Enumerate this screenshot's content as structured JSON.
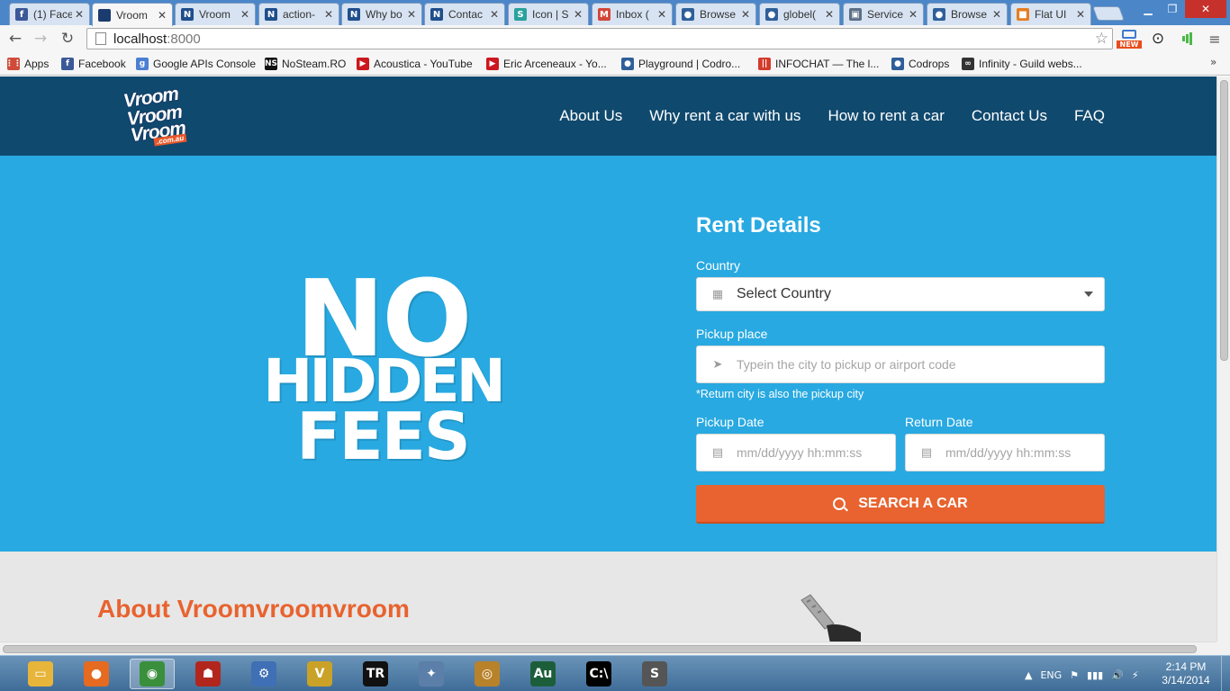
{
  "browser": {
    "tabs": [
      {
        "title": "(1) Face",
        "favicon": "facebook-icon",
        "color": "#3b5998",
        "glyph": "f"
      },
      {
        "title": "Vroom",
        "favicon": "vroom-icon",
        "color": "#1b3b6f",
        "glyph": "",
        "active": true
      },
      {
        "title": "Vroom",
        "favicon": "n-icon",
        "color": "#1f4e8c",
        "glyph": "N"
      },
      {
        "title": "action-",
        "favicon": "n-icon",
        "color": "#1f4e8c",
        "glyph": "N"
      },
      {
        "title": "Why bo",
        "favicon": "n-icon",
        "color": "#1f4e8c",
        "glyph": "N"
      },
      {
        "title": "Contac",
        "favicon": "n-icon",
        "color": "#1f4e8c",
        "glyph": "N"
      },
      {
        "title": "Icon | S",
        "favicon": "s-icon",
        "color": "#29a19c",
        "glyph": "S"
      },
      {
        "title": "Inbox (",
        "favicon": "gmail-icon",
        "color": "#d44638",
        "glyph": "M"
      },
      {
        "title": "Browse",
        "favicon": "drop-icon",
        "color": "#2f5f9a",
        "glyph": "●"
      },
      {
        "title": "globel(",
        "favicon": "drop-icon",
        "color": "#2f5f9a",
        "glyph": "●"
      },
      {
        "title": "Service",
        "favicon": "service-icon",
        "color": "#5b6f86",
        "glyph": "▣"
      },
      {
        "title": "Browse",
        "favicon": "drop-icon",
        "color": "#2f5f9a",
        "glyph": "●"
      },
      {
        "title": "Flat UI",
        "favicon": "flatui-icon",
        "color": "#e67e22",
        "glyph": "■"
      }
    ],
    "tab_close_glyph": "✕",
    "url_host": "localhost",
    "url_port": ":8000",
    "new_badge": "NEW",
    "bookmarks": [
      {
        "label": "Apps",
        "icon": "apps-grid-icon",
        "color": "#d04b3a",
        "glyph": "⋮⋮"
      },
      {
        "label": "Facebook",
        "icon": "facebook-icon",
        "color": "#3b5998",
        "glyph": "f"
      },
      {
        "label": "Google APIs Console",
        "icon": "google-icon",
        "color": "#4a7fd4",
        "glyph": "g"
      },
      {
        "label": "NoSteam.RO",
        "icon": "ns-icon",
        "color": "#111111",
        "glyph": "NS"
      },
      {
        "label": "Acoustica - YouTube",
        "icon": "youtube-icon",
        "color": "#cc181e",
        "glyph": "▶"
      },
      {
        "label": "Eric Arceneaux - Yo...",
        "icon": "youtube-icon",
        "color": "#cc181e",
        "glyph": "▶"
      },
      {
        "label": "Playground | Codro...",
        "icon": "codrops-icon",
        "color": "#2f5f9a",
        "glyph": "●"
      },
      {
        "label": "INFOCHAT — The l...",
        "icon": "infochat-icon",
        "color": "#d33b2c",
        "glyph": "||"
      },
      {
        "label": "Codrops",
        "icon": "codrops-icon",
        "color": "#2f5f9a",
        "glyph": "●"
      },
      {
        "label": "Infinity - Guild webs...",
        "icon": "infinity-icon",
        "color": "#333333",
        "glyph": "∞"
      }
    ],
    "bookmarks_more": "»"
  },
  "site": {
    "logo_lines": [
      "Vroom",
      "Vroom",
      "Vroom"
    ],
    "logo_sub": ".com.au",
    "nav": [
      "About Us",
      "Why rent a car with us",
      "How to rent a car",
      "Contact Us",
      "FAQ"
    ],
    "hero_words": [
      "NO",
      "HIDDEN",
      "FEES"
    ],
    "form": {
      "title": "Rent Details",
      "country_label": "Country",
      "country_value": "Select Country",
      "pickup_label": "Pickup place",
      "pickup_placeholder": "Typein the city to pickup or airport code",
      "hint": "*Return city is also the pickup city",
      "pickup_date_label": "Pickup Date",
      "pickup_date_placeholder": "mm/dd/yyyy hh:mm:ss",
      "return_date_label": "Return Date",
      "return_date_placeholder": "mm/dd/yyyy hh:mm:ss",
      "button": "SEARCH A CAR"
    },
    "about_title": "About Vroomvroomvroom",
    "colors": {
      "header": "#10496e",
      "hero": "#28a9e1",
      "accent": "#e8632f"
    }
  },
  "taskbar": {
    "apps": [
      {
        "name": "explorer-icon",
        "color": "#e6b53a",
        "glyph": "▭"
      },
      {
        "name": "firefox-icon",
        "color": "#e66a1f",
        "glyph": "●"
      },
      {
        "name": "chrome-icon",
        "color": "#3a8f3c",
        "glyph": "◉",
        "active": true
      },
      {
        "name": "ninja-icon",
        "color": "#b3261e",
        "glyph": "☗"
      },
      {
        "name": "network-tool-icon",
        "color": "#3f6fb5",
        "glyph": "⚙"
      },
      {
        "name": "v-app-icon",
        "color": "#c9a227",
        "glyph": "V"
      },
      {
        "name": "tr-app-icon",
        "color": "#111111",
        "glyph": "TR"
      },
      {
        "name": "starcraft-icon",
        "color": "#5b7fa8",
        "glyph": "✦"
      },
      {
        "name": "hearthstone-icon",
        "color": "#b8822a",
        "glyph": "◎"
      },
      {
        "name": "audition-icon",
        "color": "#1d5e3a",
        "glyph": "Au"
      },
      {
        "name": "cmd-icon",
        "color": "#000000",
        "glyph": "C:\\"
      },
      {
        "name": "sublime-icon",
        "color": "#555555",
        "glyph": "S"
      }
    ],
    "tray": [
      "▲",
      "ENG",
      "⚑",
      "▮▮▮",
      "🔊",
      "⚡"
    ],
    "time": "2:14 PM",
    "date": "3/14/2014"
  }
}
